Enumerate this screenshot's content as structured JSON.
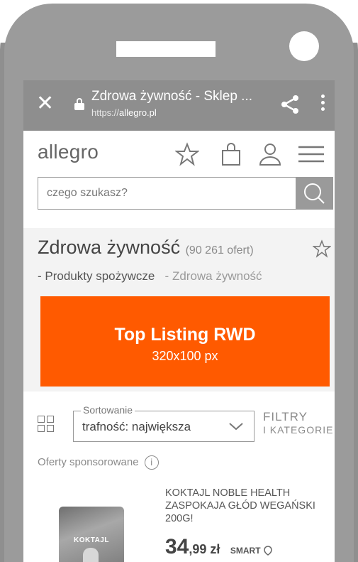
{
  "browser": {
    "page_title": "Zdrowa żywność - Sklep ...",
    "url_scheme": "https://",
    "url_host": "allegro.pl"
  },
  "header": {
    "logo": "allegro"
  },
  "search": {
    "placeholder": "czego szukasz?"
  },
  "category": {
    "title": "Zdrowa żywność",
    "count": "(90 261 ofert)",
    "breadcrumb_parent": "Produkty spożywcze",
    "breadcrumb_current": "Zdrowa żywność",
    "breadcrumb_separator": "-"
  },
  "banner": {
    "title": "Top Listing RWD",
    "size": "320x100 px",
    "color": "#ff5a00"
  },
  "sort": {
    "legend": "Sortowanie",
    "value": "trafność: największa"
  },
  "filters": {
    "line1": "FILTRY",
    "line2": "I KATEGORIE"
  },
  "sponsored": {
    "label": "Oferty sponsorowane",
    "info_glyph": "i"
  },
  "product": {
    "image_label": "KOKTAJL",
    "title": "KOKTAJL NOBLE HEALTH ZASPOKAJA GŁÓD WEGAŃSKI 200g!",
    "price_whole": "34",
    "price_fraction": ",99 zł",
    "badge": "SMART"
  }
}
